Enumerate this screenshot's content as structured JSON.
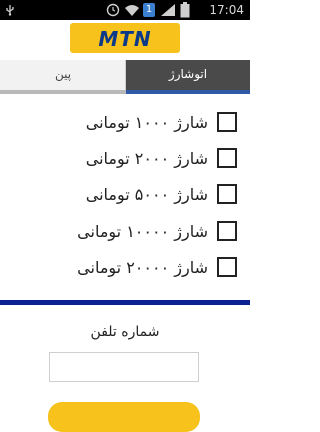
{
  "status_bar": {
    "time": "17:04",
    "notification_count": "1",
    "icons": [
      "usb-icon",
      "clock-icon",
      "wifi-icon",
      "signal-icon",
      "battery-icon"
    ]
  },
  "header": {
    "logo_text": "MTN",
    "brand_color": "#f6c21b",
    "logo_text_color": "#0b3a8a"
  },
  "tabs": [
    {
      "label": "پین",
      "selected": false
    },
    {
      "label": "اتوشارژ",
      "selected": true
    }
  ],
  "options": [
    {
      "label": "شارژ ۱۰۰۰ تومانی",
      "checked": false
    },
    {
      "label": "شارژ ۲۰۰۰ تومانی",
      "checked": false
    },
    {
      "label": "شارژ ۵۰۰۰ تومانی",
      "checked": false
    },
    {
      "label": "شارژ ۱۰۰۰۰ تومانی",
      "checked": false
    },
    {
      "label": "شارژ ۲۰۰۰۰ تومانی",
      "checked": false
    }
  ],
  "phone": {
    "label": "شماره تلفن",
    "value": ""
  },
  "colors": {
    "accent_blue": "#0a2390",
    "tab_selected_bg": "#4a4a4a"
  }
}
